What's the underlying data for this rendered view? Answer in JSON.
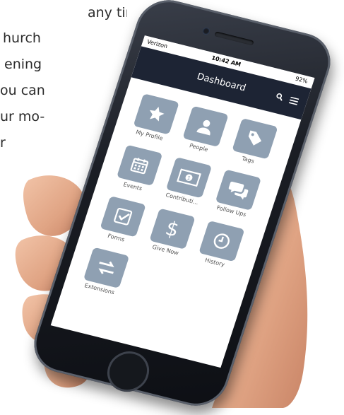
{
  "background_text": {
    "lines": [
      "any time",
      "hurch",
      "ening",
      "ou can",
      "ur mo-",
      "r"
    ]
  },
  "status_bar": {
    "carrier": "Verizon",
    "time": "10:42 AM",
    "battery": "92%"
  },
  "header": {
    "title": "Dashboard",
    "search_icon": "search-icon",
    "menu_icon": "menu-icon"
  },
  "tiles": [
    {
      "label": "My Profile",
      "icon": "star-icon"
    },
    {
      "label": "People",
      "icon": "person-icon"
    },
    {
      "label": "Tags",
      "icon": "tag-icon"
    },
    {
      "label": "Events",
      "icon": "calendar-icon"
    },
    {
      "label": "Contributi...",
      "icon": "money-icon"
    },
    {
      "label": "Follow Ups",
      "icon": "chat-icon"
    },
    {
      "label": "Forms",
      "icon": "checkbox-icon"
    },
    {
      "label": "Give Now",
      "icon": "dollar-icon"
    },
    {
      "label": "History",
      "icon": "clock-icon"
    },
    {
      "label": "Extensions",
      "icon": "arrows-icon"
    }
  ],
  "colors": {
    "header_bg": "#1d2434",
    "tile_bg": "#8fa0b2"
  }
}
